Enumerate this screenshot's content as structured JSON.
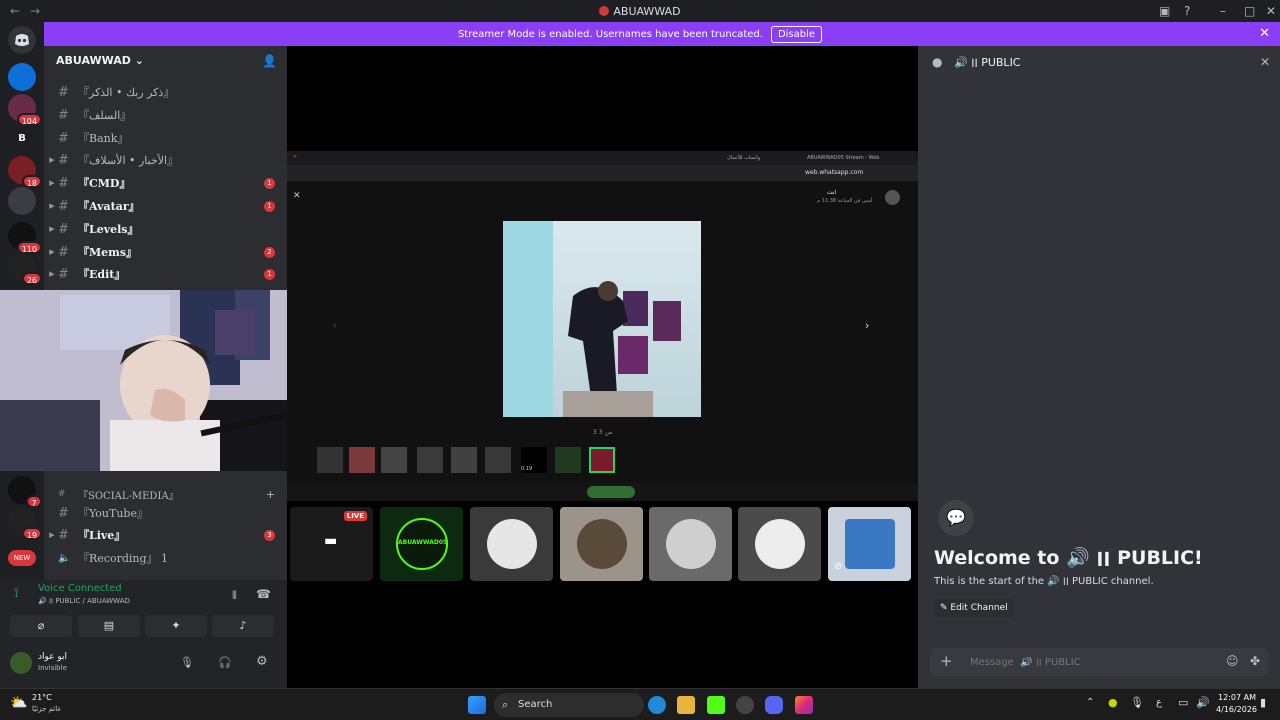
{
  "window": {
    "title": "ABUAWWAD"
  },
  "banner": {
    "message": "Streamer Mode is enabled. Usernames have been truncated.",
    "disable_label": "Disable"
  },
  "servers": [
    {
      "label": "",
      "badge": ""
    },
    {
      "label": "",
      "badge": "104"
    },
    {
      "label": "B",
      "badge": ""
    },
    {
      "label": "",
      "badge": "18"
    },
    {
      "label": "",
      "badge": ""
    },
    {
      "label": "",
      "badge": "110"
    },
    {
      "label": "",
      "badge": "26"
    },
    {
      "label": "",
      "badge": "7"
    },
    {
      "label": "",
      "badge": "19"
    },
    {
      "label": "NEW",
      "badge": ""
    }
  ],
  "sidebar": {
    "server_name": "ABUAWWAD",
    "channels_top": [
      {
        "name": "『ذكر ربك • الذكر』",
        "count": ""
      },
      {
        "name": "『السلف』",
        "count": ""
      },
      {
        "name": "『Bank』",
        "count": ""
      },
      {
        "name": "『الأخبار • الأسلاف』",
        "count": ""
      },
      {
        "name": "『CMD』",
        "count": "1"
      },
      {
        "name": "『Avatar』",
        "count": "1"
      },
      {
        "name": "『Levels』",
        "count": ""
      },
      {
        "name": "『Mems』",
        "count": "2"
      },
      {
        "name": "『Edit』",
        "count": "1"
      }
    ],
    "category": "『SOCIAL-MEDIA』",
    "channels_bottom": [
      {
        "name": "『YouTube』",
        "count": ""
      },
      {
        "name": "『Live』",
        "count": "3"
      },
      {
        "name": "『Recording』 1",
        "count": ""
      }
    ]
  },
  "voice": {
    "status": "Voice Connected",
    "channel": "PUBLIC / ABUAWWAD"
  },
  "user": {
    "name": "ابو عواد",
    "status": "Invisible"
  },
  "stream": {
    "tab_title": "ABUAWWAD05 Stream - Web",
    "tab2_title": "واتساب للأعمال",
    "url": "web.whatsapp.com",
    "chat_name": "انت",
    "chat_time": "أمس في الساعة 11:38 م",
    "media_counter": "3 من 3",
    "live_badge": "LIVE",
    "tile_caption": "0:19",
    "kick_label": "ABUAWWAD05"
  },
  "channel_panel": {
    "name": "PUBLIC",
    "welcome_prefix": "Welcome to",
    "welcome_name": "PUBLIC!",
    "intro_prefix": "This is the start of the",
    "intro_suffix": "PUBLIC channel.",
    "edit_label": "Edit Channel",
    "message_placeholder": "Message  🔊 ׀׀ PUBLIC"
  },
  "taskbar": {
    "weather_temp": "21°C",
    "weather_desc": "غائم جزئيًا",
    "search_label": "Search",
    "time": "12:07 AM",
    "date": "4/16/2026",
    "lang": "ع"
  },
  "colors": {
    "accent": "#8a3ff7",
    "voice_green": "#23a55a",
    "badge_red": "#da373c"
  }
}
